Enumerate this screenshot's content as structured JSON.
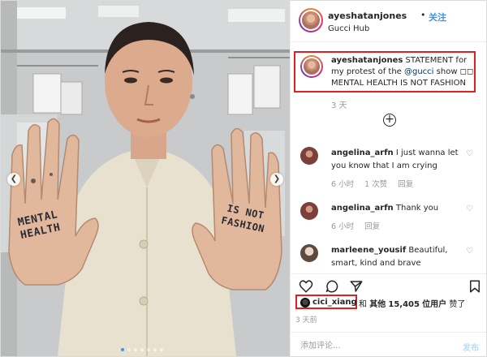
{
  "header": {
    "username": "ayeshatanjones",
    "separator": "•",
    "follow_label": "关注",
    "location": "Gucci Hub"
  },
  "caption": {
    "username": "ayeshatanjones",
    "text_before_mention": " STATEMENT for my protest of the ",
    "mention": "@gucci",
    "text_after_mention": " show ",
    "emojis": "◻◻",
    "second_line": "MENTAL HEALTH IS NOT FASHION",
    "time": "3 天"
  },
  "load_more": "+",
  "comments": [
    {
      "username": "angelina_arfn",
      "text": "I just wanna let you know that I am crying",
      "time": "6 小时",
      "likes": "1 次赞",
      "reply": "回复"
    },
    {
      "username": "angelina_arfn",
      "text": "Thank you",
      "time": "6 小时",
      "likes": "",
      "reply": "回复"
    },
    {
      "username": "marleene_yousif",
      "text": "Beautiful, smart, kind and brave",
      "time": "",
      "likes": "",
      "reply": ""
    }
  ],
  "likes": {
    "first_user": "cici_xiang",
    "connector": "和",
    "others_label": "其他",
    "count": "15,405",
    "users_label": "位用户",
    "suffix": "赞了"
  },
  "post_time": "3 天前",
  "add_comment": {
    "placeholder": "添加评论...",
    "post_label": "发布"
  },
  "icons": {
    "heart": "heart-icon",
    "comment": "comment-icon",
    "share": "share-icon",
    "save": "bookmark-icon",
    "prev": "chevron-left-icon",
    "next": "chevron-right-icon"
  },
  "photo": {
    "left_hand_text": "MENTAL HEALTH",
    "right_hand_text": "IS NOT FASHION"
  },
  "colors": {
    "accent": "#3897f0",
    "highlight_box": "#e02020",
    "muted": "#999999"
  }
}
